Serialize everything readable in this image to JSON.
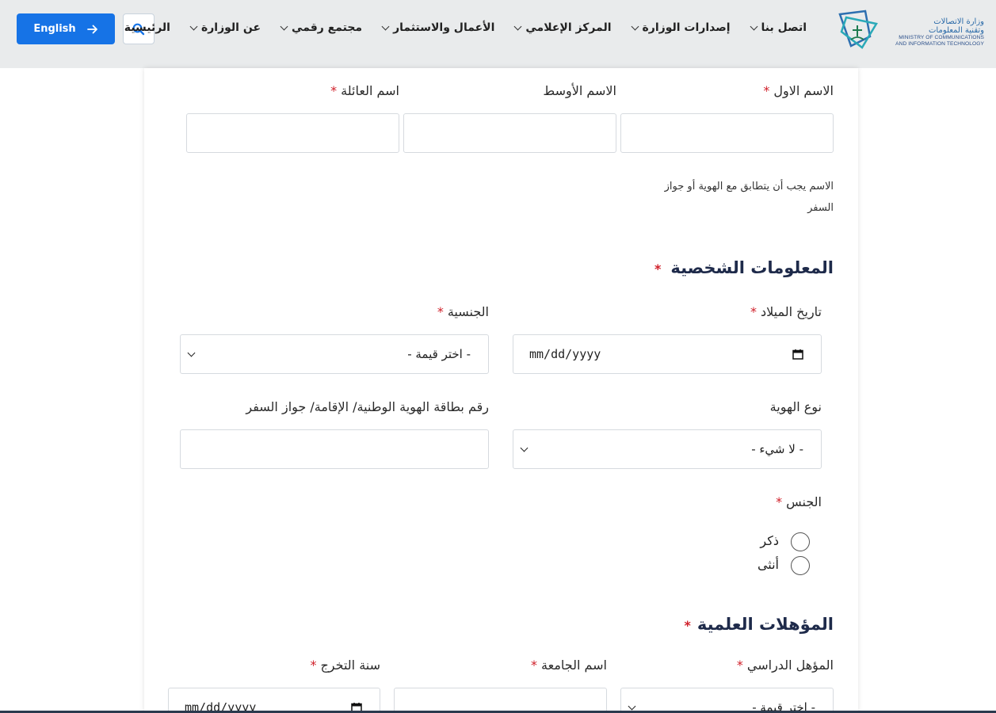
{
  "header": {
    "language_button": "English",
    "nav": [
      {
        "label": "الرئيسية",
        "has_dropdown": false
      },
      {
        "label": "عن الوزارة",
        "has_dropdown": true
      },
      {
        "label": "مجتمع رقمي",
        "has_dropdown": true
      },
      {
        "label": "الأعمال والاستثمار",
        "has_dropdown": true
      },
      {
        "label": "المركز الإعلامي",
        "has_dropdown": true
      },
      {
        "label": "إصدارات الوزارة",
        "has_dropdown": true
      },
      {
        "label": "اتصل بنا",
        "has_dropdown": true
      }
    ],
    "logo": {
      "arabic_line1": "وزارة الاتصالات",
      "arabic_line2": "وتقنية المعلومات",
      "english_line1": "MINISTRY OF COMMUNICATIONS",
      "english_line2": "AND INFORMATION TECHNOLOGY"
    }
  },
  "name_section": {
    "first_name_label": "الاسم الاول",
    "middle_name_label": "الاسم الأوسط",
    "family_name_label": "اسم العائلة",
    "first_name_value": "",
    "middle_name_value": "",
    "family_name_value": "",
    "note_line1": "الاسم يجب أن يتطابق مع الهوية أو جواز",
    "note_line2": "السفر"
  },
  "personal_section": {
    "title": "المعلومات الشخصية",
    "birth_date_label": "تاريخ الميلاد",
    "birth_date_value": "mm/dd/yyyy",
    "nationality_label": "الجنسية",
    "nationality_value": "- اختر قيمة -",
    "id_type_label": "نوع الهوية",
    "id_type_value": "- لا شيء -",
    "id_number_label": "رقم بطاقة الهوية الوطنية/ الإقامة/ جواز السفر",
    "id_number_value": "",
    "gender_label": "الجنس",
    "gender_options": [
      "ذكر",
      "أنثى"
    ]
  },
  "education_section": {
    "title": "المؤهلات العلمية",
    "degree_label": "المؤهل الدراسي",
    "degree_value": "- اختر قيمة -",
    "university_label": "اسم الجامعة",
    "university_value": "",
    "graduation_year_label": "سنة التخرج",
    "graduation_year_value": "mm/dd/yyyy"
  },
  "required_marker": "*",
  "colors": {
    "primary_button": "#1673e6",
    "header_background": "#e9ebec",
    "required": "#d0202a",
    "section_title": "#1e2a4a"
  }
}
